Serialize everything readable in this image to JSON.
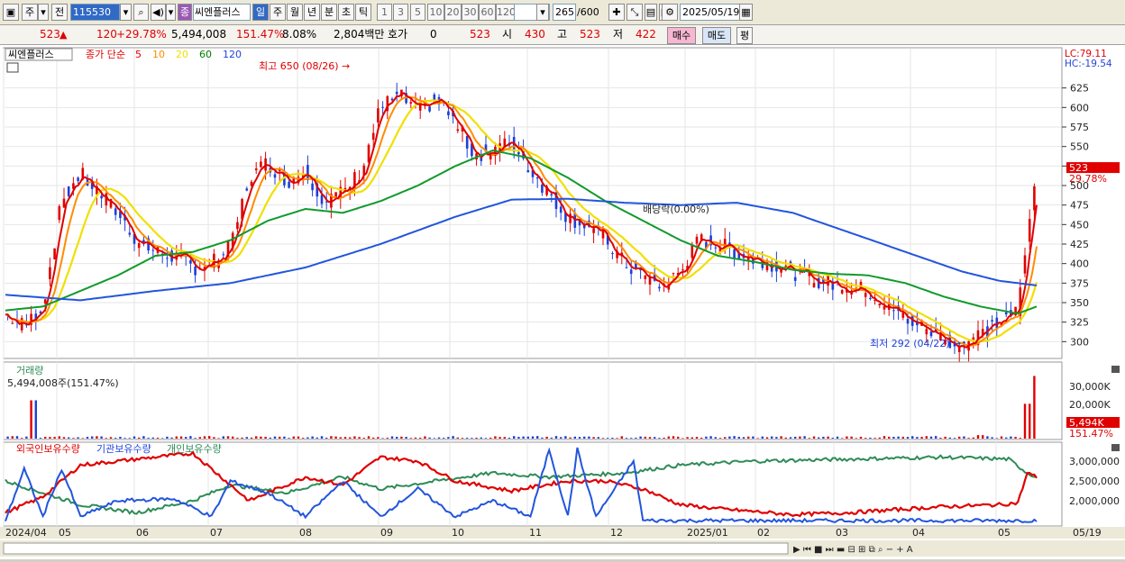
{
  "toolbar": {
    "period": "주",
    "prev": "전",
    "code": "115530",
    "audio": "◀)",
    "name_tag": "종",
    "stock_name": "씨엔플러스",
    "periods": [
      "일",
      "주",
      "월",
      "년",
      "분",
      "초",
      "틱"
    ],
    "nums": [
      "1",
      "3",
      "5",
      "10",
      "20",
      "30",
      "60",
      "120"
    ],
    "count": "265",
    "count_max": "/600",
    "date": "2025/05/19"
  },
  "quote": {
    "price": "523",
    "change": "120",
    "change_pct": "+29.78%",
    "volume": "5,494,008",
    "vol_ratio": "151.47%",
    "turnover": "8.08%",
    "amount": "2,804백만",
    "hoga_label": "호가",
    "hoga_val": "0",
    "hoga_price": "523",
    "open_label": "시",
    "open": "430",
    "high_label": "고",
    "high": "523",
    "low_label": "저",
    "low": "422",
    "buy_label": "매수",
    "sell_label": "매도",
    "flat_label": "평"
  },
  "chart": {
    "stock_tag": "씨엔플러스",
    "legend_prefix": "종가 단순",
    "ma": [
      {
        "label": "5",
        "color": "#e00000"
      },
      {
        "label": "10",
        "color": "#ff8c00"
      },
      {
        "label": "20",
        "color": "#f0e000"
      },
      {
        "label": "60",
        "color": "#008000"
      },
      {
        "label": "120",
        "color": "#2244dd"
      }
    ],
    "lc": "LC:79.11",
    "hc": "HC:-19.54",
    "price_ticks": [
      "625",
      "600",
      "575",
      "550",
      "525",
      "500",
      "475",
      "450",
      "425",
      "400",
      "375",
      "350",
      "325",
      "300"
    ],
    "current_price": "523",
    "current_pct": "29.78%",
    "high_note": "최고 650 (08/26)",
    "low_note": "최저 292 (04/22)",
    "dividend": "배당락(0.00%)",
    "volume_title": "거래량",
    "volume_value": "5,494,008주(151.47%)",
    "volume_ticks": [
      "30,000K",
      "20,000K",
      "10,000K"
    ],
    "volume_current": "5,494K",
    "volume_pct": "151.47%",
    "holdings": [
      "외국인보유수량",
      "기관보유수량",
      "개인보유수량"
    ],
    "holdings_colors": [
      "#e00000",
      "#2244dd",
      "#2e8b57"
    ],
    "holdings_ticks": [
      "3,000,000",
      "2,500,000",
      "2,000,000"
    ],
    "x_labels": [
      "2024/04",
      "05",
      "06",
      "07",
      "08",
      "09",
      "10",
      "11",
      "12",
      "2025/01",
      "02",
      "03",
      "04",
      "05",
      "05/19"
    ]
  },
  "chart_data": {
    "type": "candlestick",
    "y_range": [
      290,
      650
    ],
    "close_path": [
      [
        0,
        335
      ],
      [
        2,
        320
      ],
      [
        4,
        345
      ],
      [
        6,
        480
      ],
      [
        8,
        515
      ],
      [
        10,
        490
      ],
      [
        12,
        465
      ],
      [
        14,
        430
      ],
      [
        16,
        415
      ],
      [
        18,
        410
      ],
      [
        20,
        395
      ],
      [
        22,
        400
      ],
      [
        24,
        420
      ],
      [
        26,
        510
      ],
      [
        28,
        530
      ],
      [
        30,
        505
      ],
      [
        32,
        520
      ],
      [
        34,
        480
      ],
      [
        36,
        490
      ],
      [
        38,
        520
      ],
      [
        40,
        600
      ],
      [
        42,
        615
      ],
      [
        44,
        595
      ],
      [
        46,
        610
      ],
      [
        48,
        580
      ],
      [
        50,
        540
      ],
      [
        52,
        545
      ],
      [
        54,
        555
      ],
      [
        56,
        520
      ],
      [
        58,
        490
      ],
      [
        60,
        460
      ],
      [
        62,
        450
      ],
      [
        64,
        430
      ],
      [
        66,
        400
      ],
      [
        68,
        385
      ],
      [
        70,
        370
      ],
      [
        72,
        390
      ],
      [
        74,
        430
      ],
      [
        76,
        425
      ],
      [
        78,
        415
      ],
      [
        80,
        405
      ],
      [
        82,
        400
      ],
      [
        84,
        390
      ],
      [
        86,
        380
      ],
      [
        88,
        375
      ],
      [
        90,
        370
      ],
      [
        92,
        365
      ],
      [
        94,
        345
      ],
      [
        96,
        330
      ],
      [
        98,
        318
      ],
      [
        100,
        305
      ],
      [
        102,
        295
      ],
      [
        104,
        310
      ],
      [
        106,
        325
      ],
      [
        108,
        340
      ],
      [
        110,
        523
      ]
    ],
    "ma60_path": [
      [
        0,
        340
      ],
      [
        4,
        345
      ],
      [
        8,
        365
      ],
      [
        12,
        385
      ],
      [
        16,
        410
      ],
      [
        20,
        415
      ],
      [
        24,
        430
      ],
      [
        28,
        455
      ],
      [
        32,
        470
      ],
      [
        36,
        465
      ],
      [
        40,
        480
      ],
      [
        44,
        500
      ],
      [
        48,
        525
      ],
      [
        52,
        545
      ],
      [
        56,
        535
      ],
      [
        60,
        510
      ],
      [
        64,
        480
      ],
      [
        68,
        455
      ],
      [
        72,
        430
      ],
      [
        76,
        410
      ],
      [
        80,
        402
      ],
      [
        84,
        392
      ],
      [
        88,
        387
      ],
      [
        92,
        385
      ],
      [
        96,
        375
      ],
      [
        100,
        358
      ],
      [
        104,
        345
      ],
      [
        108,
        336
      ],
      [
        110,
        345
      ]
    ],
    "ma120_path": [
      [
        0,
        360
      ],
      [
        8,
        353
      ],
      [
        16,
        365
      ],
      [
        24,
        375
      ],
      [
        32,
        395
      ],
      [
        40,
        425
      ],
      [
        48,
        460
      ],
      [
        54,
        482
      ],
      [
        60,
        483
      ],
      [
        66,
        478
      ],
      [
        72,
        475
      ],
      [
        78,
        478
      ],
      [
        84,
        465
      ],
      [
        90,
        440
      ],
      [
        96,
        415
      ],
      [
        102,
        390
      ],
      [
        106,
        378
      ],
      [
        110,
        372
      ]
    ],
    "volume_spikes_k": [
      [
        3,
        22
      ],
      [
        104,
        2
      ],
      [
        109,
        20
      ],
      [
        110,
        36
      ]
    ],
    "holdings_range": [
      1500000,
      3300000
    ]
  }
}
